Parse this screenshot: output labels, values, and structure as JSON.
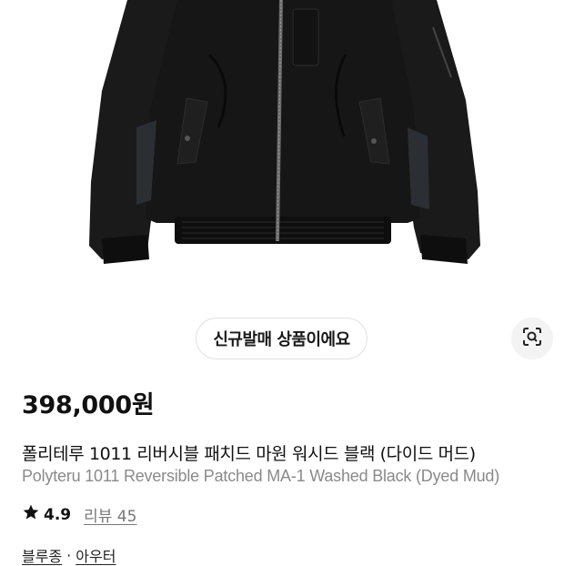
{
  "product": {
    "image_icon": "jacket-photo",
    "new_badge": "신규발매 상품이에요",
    "lens_icon": "image-search-icon",
    "price": "398,000원",
    "title_ko": "폴리테루 1011 리버시블 패치드 마원 워시드 블랙 (다이드 머드)",
    "title_en": "Polyteru 1011 Reversible Patched MA-1 Washed Black (Dyed Mud)",
    "rating": "4.9",
    "review_label": "리뷰 45",
    "category": {
      "primary": "블루종",
      "separator": "·",
      "secondary": "아우터"
    }
  },
  "colors": {
    "star": "#111111",
    "subtitle": "#8a8a8a",
    "badge_border": "#e2e2e2"
  }
}
